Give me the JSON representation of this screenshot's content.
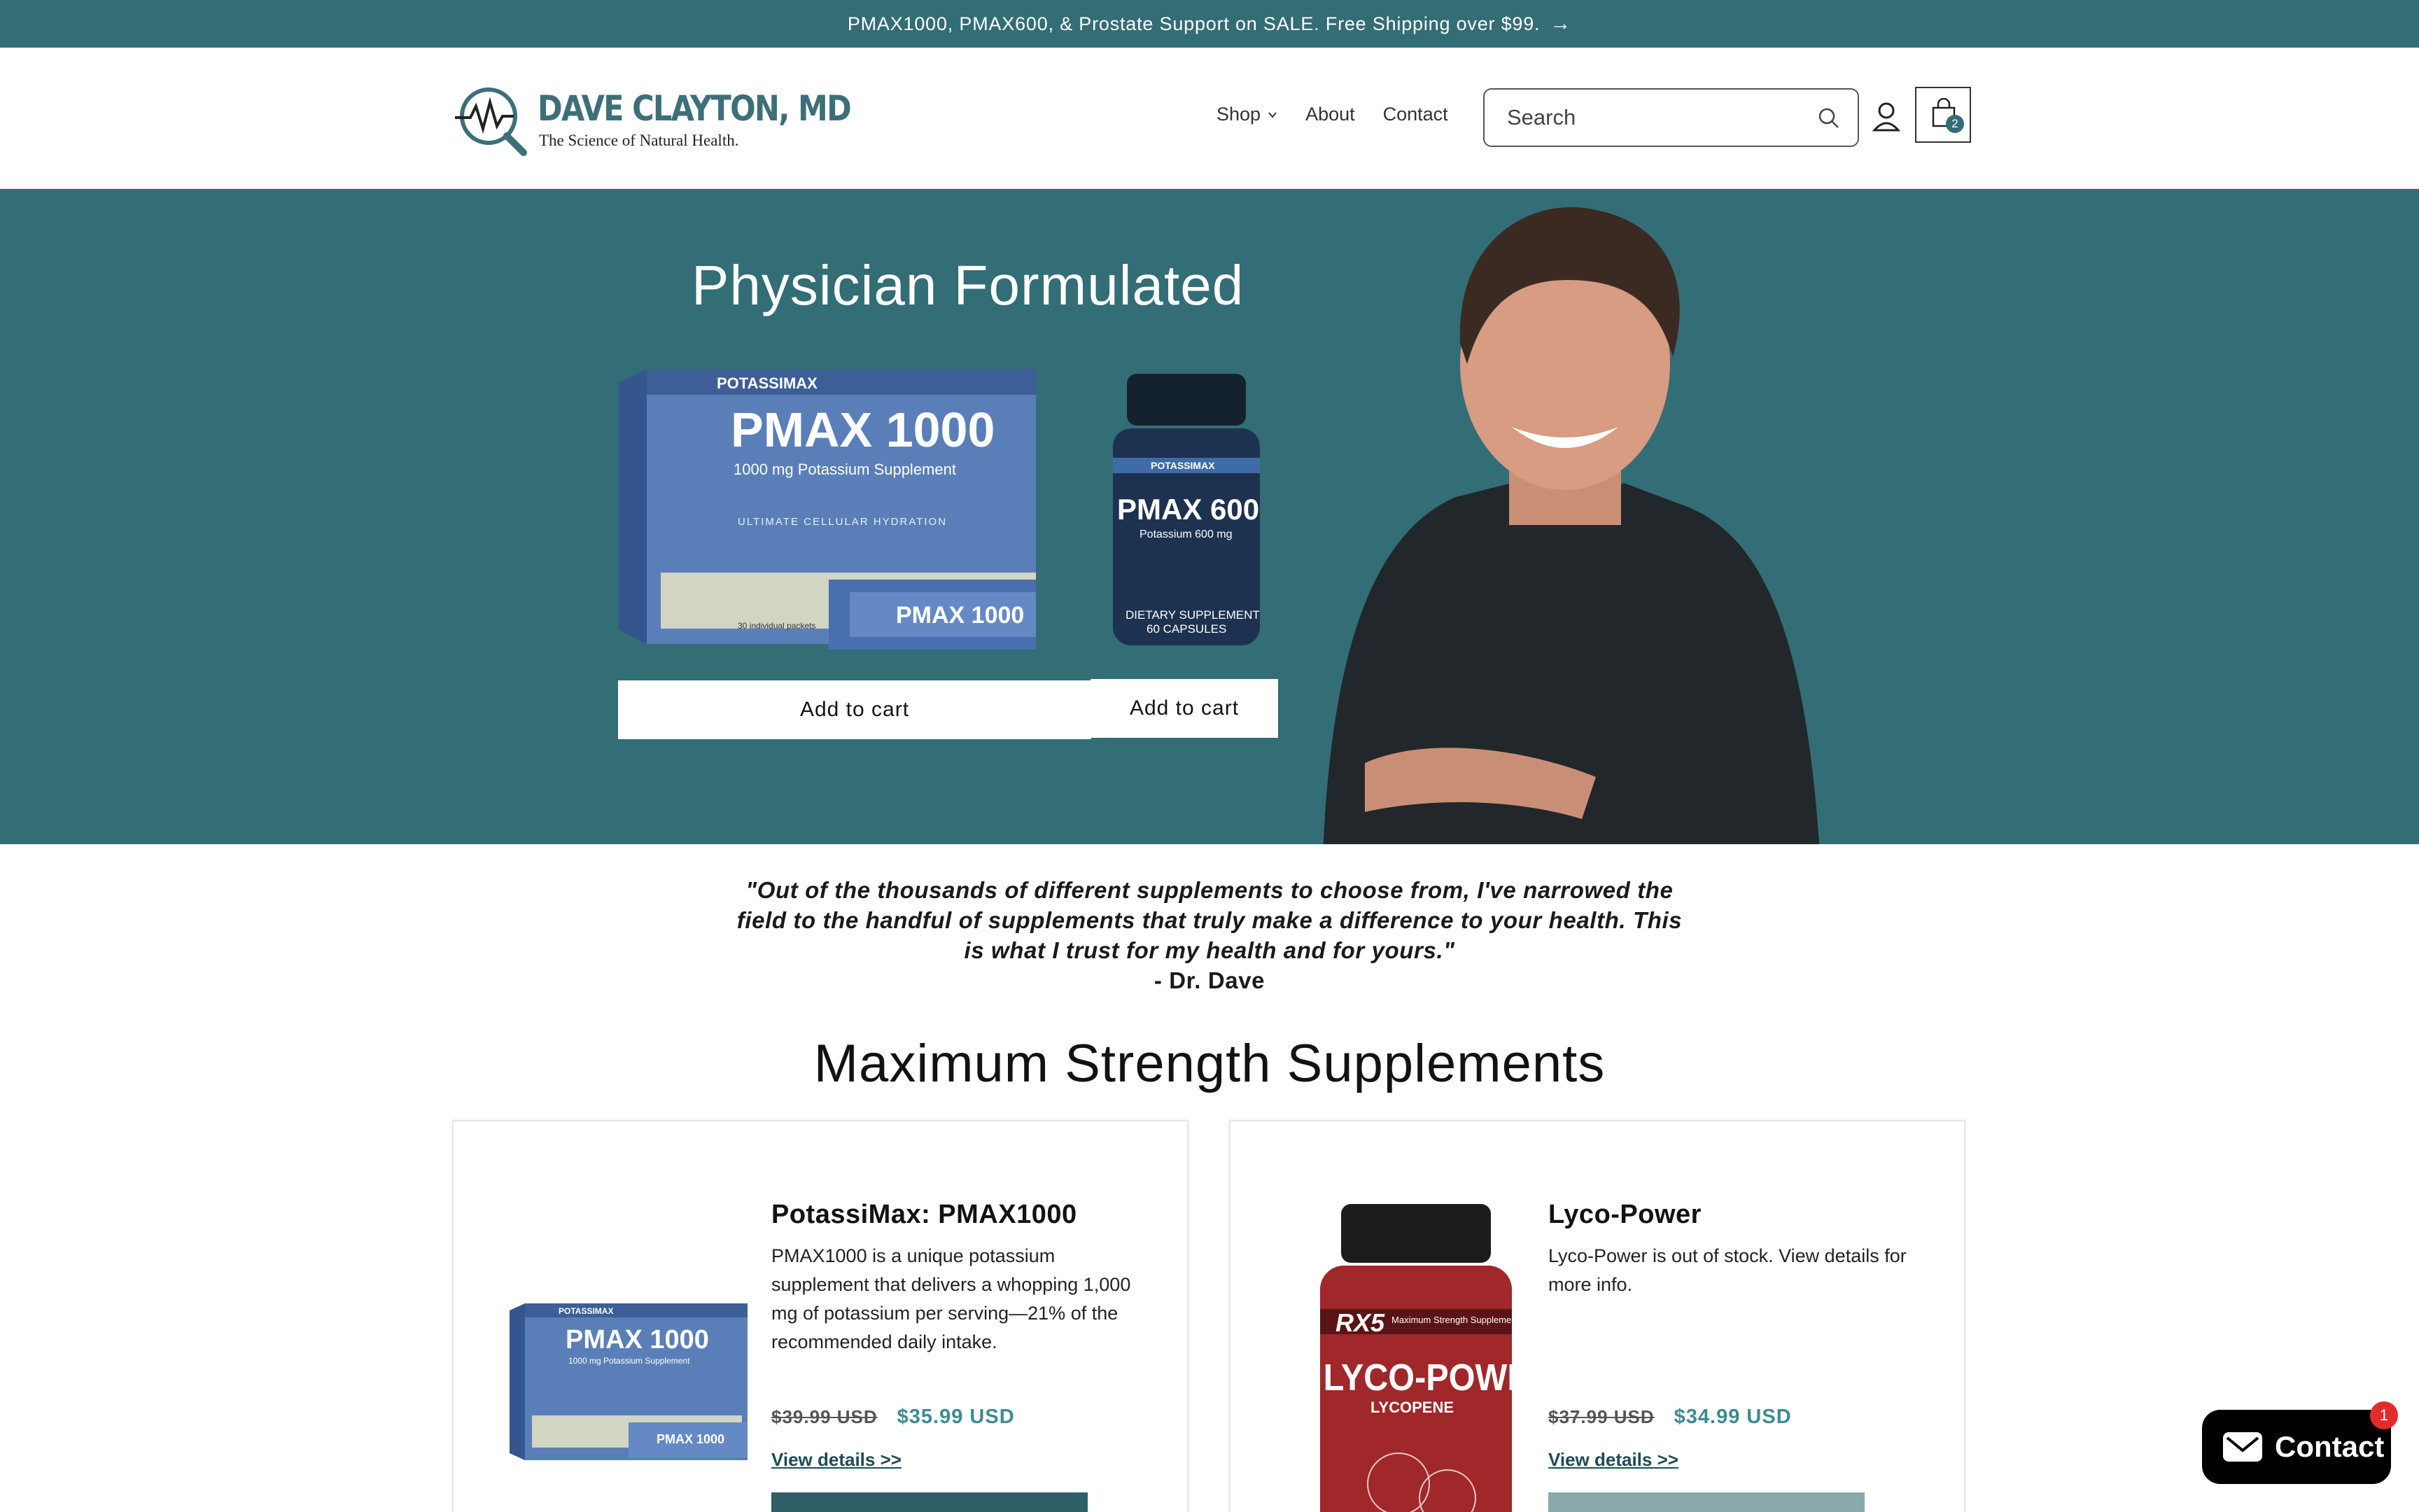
{
  "announcement": {
    "text": "PMAX1000, PMAX600, & Prostate Support on SALE. Free Shipping over $99.",
    "arrow": "→"
  },
  "header": {
    "logo_name": "DAVE CLAYTON, MD",
    "logo_tagline": "The Science of Natural Health.",
    "nav": [
      {
        "label": "Shop",
        "has_dropdown": true
      },
      {
        "label": "About"
      },
      {
        "label": "Contact"
      }
    ],
    "search_placeholder": "Search",
    "cart_count": "2"
  },
  "hero": {
    "title": "Physician Formulated",
    "product1": {
      "brand": "POTASSIMAX",
      "name": "PMAX 1000",
      "sub": "1000 mg Potassium Supplement",
      "ribbon": "ULTIMATE CELLULAR HYDRATION",
      "packets": "30 individual packets"
    },
    "product2": {
      "brand": "POTASSIMAX",
      "name": "PMAX 600",
      "sub": "Potassium 600 mg",
      "label1": "DIETARY SUPPLEMENT",
      "label2": "60 CAPSULES"
    },
    "add_to_cart_1": "Add to cart",
    "add_to_cart_2": "Add to cart"
  },
  "quote": {
    "lines": [
      "\"Out of the thousands of different supplements to choose from, I've narrowed the",
      "field to the handful of supplements that truly make a difference to your health. This",
      "is what I trust for my health and for yours.\""
    ],
    "author": "- Dr. Dave"
  },
  "section_title": "Maximum Strength Supplements",
  "products": [
    {
      "title": "PotassiMax: PMAX1000",
      "description": "PMAX1000 is a unique potassium supplement that delivers a whopping 1,000 mg of potassium per serving—21% of the recommended daily intake.",
      "old_price": "$39.99 USD",
      "new_price": "$35.99 USD",
      "link": "View details >>",
      "image": {
        "brand": "POTASSIMAX",
        "name": "PMAX 1000",
        "sub": "1000 mg Potassium Supplement"
      }
    },
    {
      "title": "Lyco-Power",
      "description": "Lyco-Power is out of stock. View details for more info.",
      "old_price": "$37.99 USD",
      "new_price": "$34.99 USD",
      "link": "View details >>",
      "image": {
        "brand": "RX5",
        "tag": "Maximum Strength Supplementation",
        "name": "LYCO-POWER",
        "sub": "LYCOPENE"
      }
    }
  ],
  "chat": {
    "label": "Contact",
    "badge": "1"
  },
  "colors": {
    "teal": "#336d76",
    "price": "#3d8a94",
    "chat": "#000000",
    "badge": "#e42b2b"
  }
}
